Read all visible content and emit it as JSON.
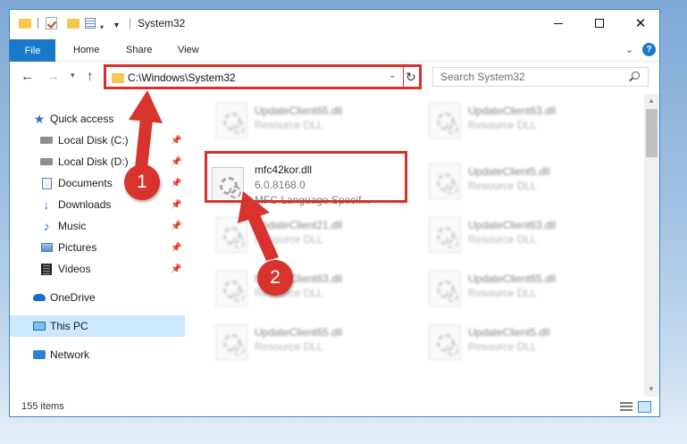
{
  "window": {
    "title": "System32",
    "controls": {
      "minimize": "",
      "maximize": "",
      "close": "✕"
    }
  },
  "ribbon": {
    "tabs": [
      "File",
      "Home",
      "Share",
      "View"
    ],
    "help": "?"
  },
  "address": {
    "path": "C:\\Windows\\System32",
    "search_placeholder": "Search System32"
  },
  "sidebar": {
    "items": [
      {
        "label": "Quick access",
        "icon": "star-icon"
      },
      {
        "label": "Local Disk (C:)",
        "icon": "drive-icon",
        "pinned": true
      },
      {
        "label": "Local Disk (D:)",
        "icon": "drive-icon",
        "pinned": true
      },
      {
        "label": "Documents",
        "icon": "documents-icon",
        "pinned": true
      },
      {
        "label": "Downloads",
        "icon": "downloads-icon",
        "pinned": true
      },
      {
        "label": "Music",
        "icon": "music-icon",
        "pinned": true
      },
      {
        "label": "Pictures",
        "icon": "pictures-icon",
        "pinned": true
      },
      {
        "label": "Videos",
        "icon": "videos-icon",
        "pinned": true
      },
      {
        "label": "OneDrive",
        "icon": "cloud-icon"
      },
      {
        "label": "This PC",
        "icon": "computer-icon",
        "selected": true
      },
      {
        "label": "Network",
        "icon": "network-icon"
      }
    ]
  },
  "files": {
    "left": [
      {
        "name": "UpdateClient65.dll",
        "desc": "Resource DLL"
      },
      {
        "name": "mfc42kor.dll",
        "version": "6.0.8168.0",
        "desc": "MFC Language Specif..."
      },
      {
        "name": "UpdateClient21.dll",
        "desc": "Resource DLL"
      },
      {
        "name": "UpdateClient63.dll",
        "desc": "Resource DLL"
      },
      {
        "name": "UpdateClient65.dll",
        "desc": "Resource DLL"
      }
    ],
    "right": [
      {
        "name": "UpdateClient63.dll",
        "desc": "Resource DLL"
      },
      {
        "name": "UpdateClient5.dll",
        "desc": "Resource DLL"
      },
      {
        "name": "UpdateClient63.dll",
        "desc": "Resource DLL"
      },
      {
        "name": "UpdateClient65.dll",
        "desc": "Resource DLL"
      },
      {
        "name": "UpdateClient5.dll",
        "desc": "Resource DLL"
      }
    ]
  },
  "status": {
    "count": "155 items"
  },
  "callouts": {
    "one": "1",
    "two": "2"
  },
  "colors": {
    "accent": "#1979ca",
    "highlight": "#d8312d",
    "selection": "#cce8ff"
  }
}
